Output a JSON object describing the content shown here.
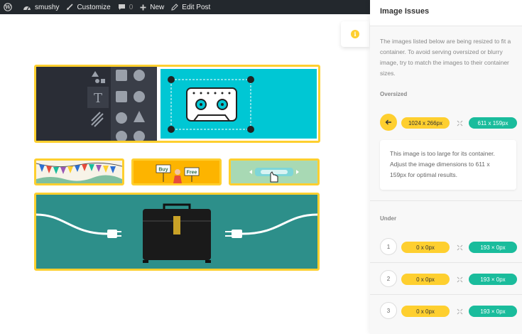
{
  "adminbar": {
    "site_name": "smushy",
    "customize": "Customize",
    "comments_count": "0",
    "new_label": "New",
    "edit_post": "Edit Post"
  },
  "panel": {
    "title": "Image Issues",
    "description": "The images listed below are being resized to fit a container. To avoid serving oversized or blurry image, try to match the images to their container sizes.",
    "oversized_label": "Oversized",
    "oversized": {
      "image_size": "1024 x 266px",
      "container_size": "611 x 159px"
    },
    "message": "This image is too large for its container. Adjust the image dimensions to 611 x 159px for optimal results.",
    "under_label": "Under",
    "under_rows": [
      {
        "index": "1",
        "image_size": "0 x 0px",
        "container_size": "193 × 0px"
      },
      {
        "index": "2",
        "image_size": "0 x 0px",
        "container_size": "193 × 0px"
      },
      {
        "index": "3",
        "image_size": "0 x 0px",
        "container_size": "193 × 0px"
      }
    ]
  },
  "banner_texts": {
    "buy": "Buy",
    "free": "Free"
  },
  "colors": {
    "accent_yellow": "#fecf2f",
    "accent_green": "#1abc9c",
    "adminbar": "#23282d",
    "teal": "#00c7d4",
    "sea": "#2d8f8a"
  }
}
